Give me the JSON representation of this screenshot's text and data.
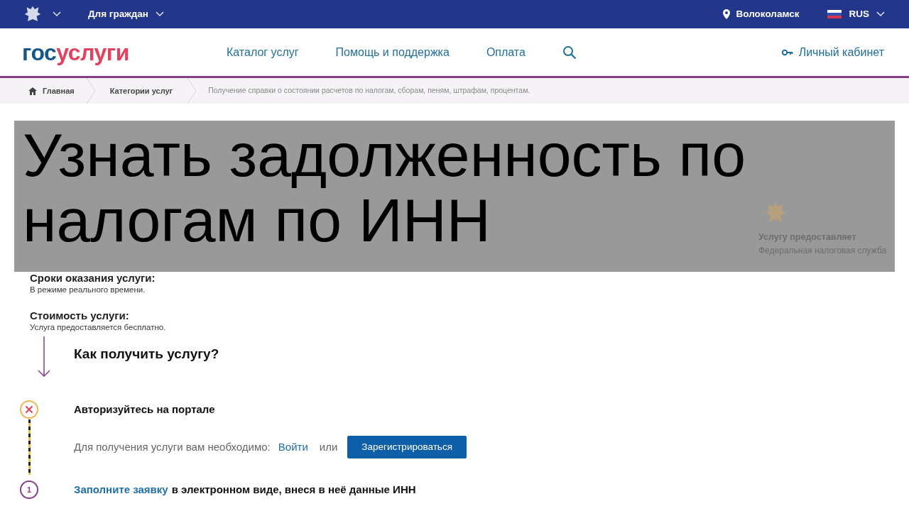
{
  "top_bar": {
    "audience_menu": "Для граждан",
    "location": "Волоколамск",
    "language": "RUS"
  },
  "header": {
    "logo": {
      "first": "гос",
      "second": "услуги"
    },
    "nav": [
      "Каталог услуг",
      "Помощь и поддержка",
      "Оплата"
    ],
    "account": "Личный кабинет"
  },
  "breadcrumbs": [
    {
      "kind": "home",
      "label": "Главная"
    },
    {
      "kind": "link",
      "label": "Категории услуг"
    },
    {
      "kind": "current",
      "label": "Получение справки о состоянии расчетов по налогам, сборам, пеням, штрафам, процентам."
    }
  ],
  "banner": {
    "title": "Узнать задолженность по налогам по ИНН"
  },
  "provider": {
    "label": "Услугу предоставляет",
    "name": "Федеральная налоговая служба"
  },
  "info": [
    {
      "heading": "Сроки оказания услуги:",
      "text": "В режиме реального времени."
    },
    {
      "heading": "Стоимость услуги:",
      "text": "Услуга предоставляется бесплатно."
    }
  ],
  "how_to": {
    "title": "Как получить услугу?"
  },
  "steps": [
    {
      "kind": "auth",
      "title": "Авторизуйтесь на портале",
      "prompt": "Для получения услуги вам необходимо:",
      "login_link": "Войти",
      "or": "или",
      "register_button": "Зарегистрироваться"
    },
    {
      "kind": "form",
      "number": "1",
      "link": "Заполните заявку",
      "text": "в электронном виде, внеся в неё данные ИНН"
    }
  ]
}
